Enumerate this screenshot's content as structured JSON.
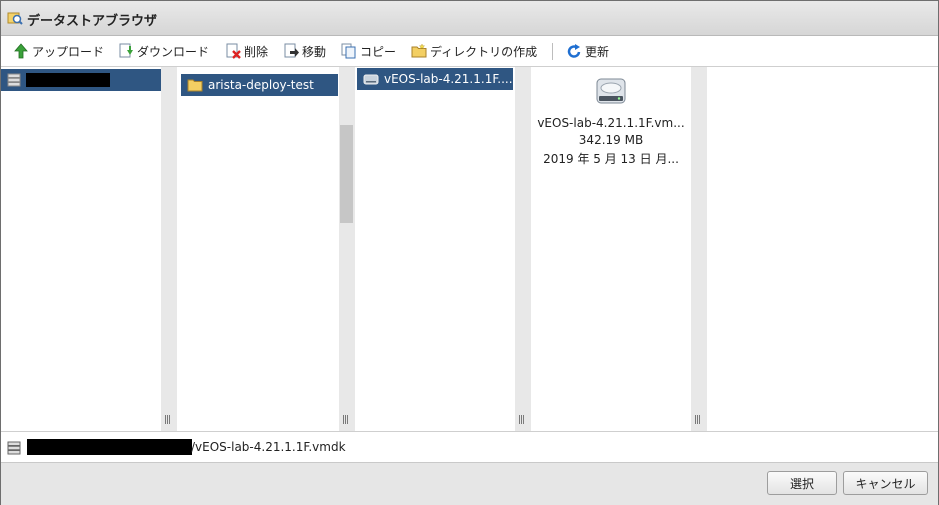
{
  "window": {
    "title": "データストアブラウザ"
  },
  "toolbar": {
    "upload": "アップロード",
    "download": "ダウンロード",
    "delete": "削除",
    "move": "移動",
    "copy": "コピー",
    "new_folder": "ディレクトリの作成",
    "refresh": "更新"
  },
  "columns": {
    "col2_folder": "arista-deploy-test",
    "col3_file": "vEOS-lab-4.21.1.1F...."
  },
  "preview": {
    "name": "vEOS-lab-4.21.1.1F.vm...",
    "size": "342.19 MB",
    "date": "2019 年 5 月 13 日 月..."
  },
  "path": {
    "suffix": "/vEOS-lab-4.21.1.1F.vmdk"
  },
  "buttons": {
    "select": "選択",
    "cancel": "キャンセル"
  },
  "colors": {
    "selection": "#2f5682"
  }
}
